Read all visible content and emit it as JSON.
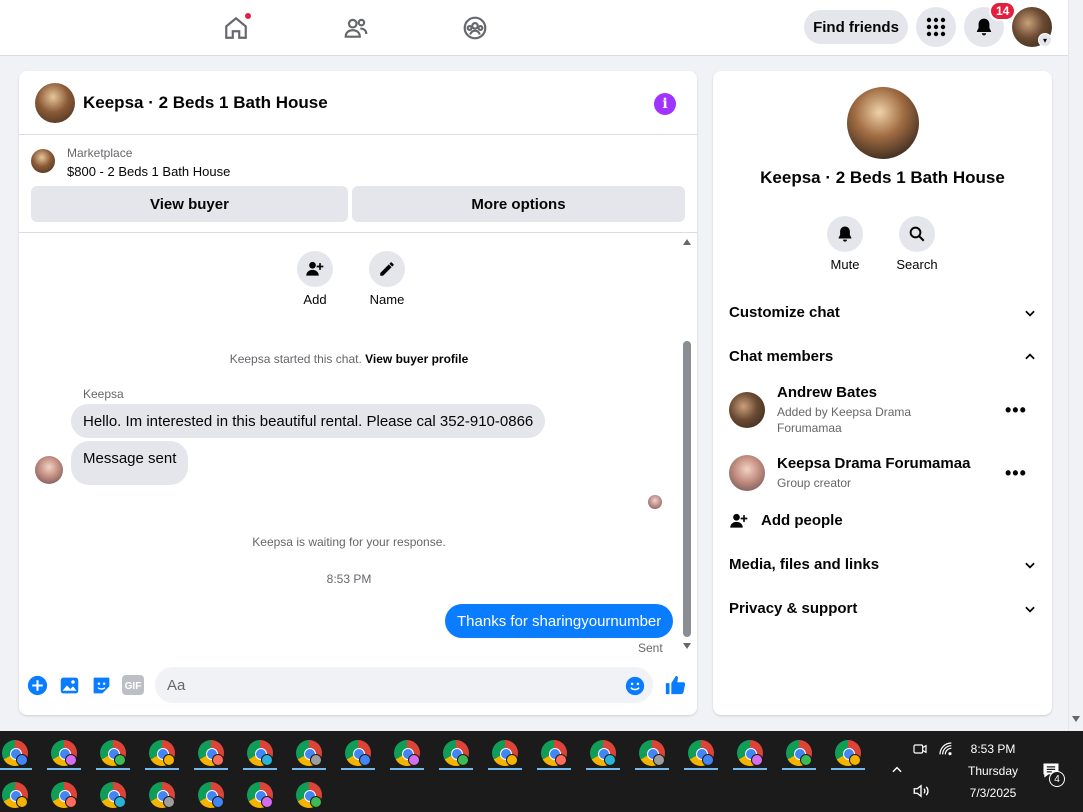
{
  "topbar": {
    "find_friends_label": "Find friends",
    "notification_count": "14",
    "nav_icons": [
      "home-icon",
      "friends-icon",
      "groups-icon"
    ],
    "right_icons": [
      "menu-grid-icon",
      "bell-icon",
      "account-avatar"
    ]
  },
  "chat": {
    "title": "Keepsa · 2 Beds 1 Bath House",
    "marketplace_label": "Marketplace",
    "listing": "$800 - 2 Beds 1 Bath House",
    "view_buyer_label": "View buyer",
    "more_options_label": "More options",
    "actions": [
      {
        "label": "Add",
        "icon": "add-person-icon"
      },
      {
        "label": "Name",
        "icon": "pencil-icon"
      }
    ],
    "started_text": "Keepsa started this chat.",
    "view_buyer_profile_label": "View buyer profile",
    "sender_name": "Keepsa",
    "messages_in": [
      "Hello. Im interested in this beautiful rental. Please cal 352-910-0866",
      "Message sent"
    ],
    "waiting_text": "Keepsa is waiting for your response.",
    "time": "8:53 PM",
    "message_out": "Thanks for sharingyournumber",
    "sent_label": "Sent",
    "composer_placeholder": "Aa",
    "composer_icons": [
      "plus-circle-icon",
      "photo-icon",
      "sticker-icon",
      "gif-icon",
      "emoji-icon",
      "thumbs-up-icon"
    ],
    "gif_text": "GIF"
  },
  "info": {
    "title": "Keepsa · 2 Beds 1 Bath House",
    "mute_label": "Mute",
    "search_label": "Search",
    "customize_label": "Customize chat",
    "members_label": "Chat members",
    "members": [
      {
        "name": "Andrew Bates",
        "sub": "Added by Keepsa Drama Forumamaa"
      },
      {
        "name": "Keepsa Drama Forumamaa",
        "sub": "Group creator"
      }
    ],
    "add_people_label": "Add people",
    "media_label": "Media, files and links",
    "privacy_label": "Privacy & support"
  },
  "taskbar": {
    "time": "8:53 PM",
    "day": "Thursday",
    "date": "7/3/2025",
    "notification_count": "4",
    "app_icon": "chrome-profile-icon"
  },
  "colors": {
    "accent_blue": "#0a7cff",
    "badge_red": "#e41e3f",
    "info_purple": "#a033ff",
    "panel_bg": "#f0f2f5",
    "button_gray": "#e4e6eb"
  }
}
